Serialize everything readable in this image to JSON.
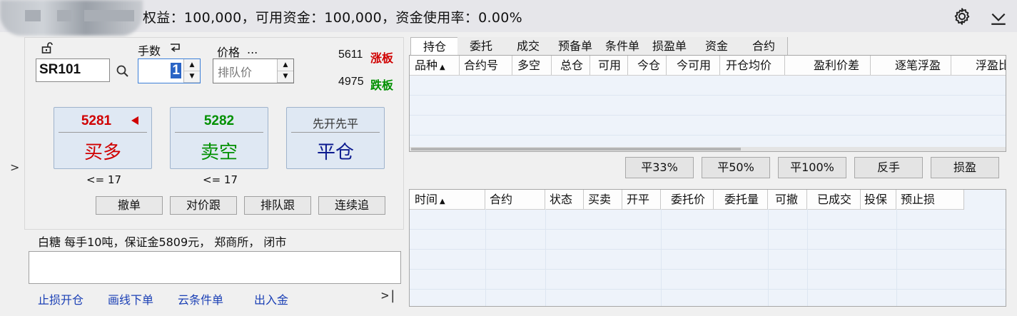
{
  "summary": "权益：100,000，可用资金：100,000，资金使用率：0.00%",
  "order": {
    "qty_label": "手数",
    "price_label": "价格",
    "price_more": "...",
    "code": "SR101",
    "qty": "1",
    "price_placeholder": "排队价",
    "limit_up_value": "5611",
    "limit_up_label": "涨板",
    "limit_down_value": "4975",
    "limit_down_label": "跌板"
  },
  "buttons": {
    "buy_price": "5281",
    "buy_label": "买多",
    "sell_price": "5282",
    "sell_label": "卖空",
    "close_mode": "先开先平",
    "close_label": "平仓",
    "buy_limit": "<= 17",
    "sell_limit": "<= 17"
  },
  "small_buttons": [
    "撤单",
    "对价跟",
    "排队跟",
    "连续追"
  ],
  "contract_info": "白糖  每手10吨，保证金5809元， 郑商所， 闭市",
  "links": [
    "止损开仓",
    "画线下单",
    "云条件单",
    "出入金"
  ],
  "more_icon": ">|",
  "expand_icon": ">",
  "tabs": [
    "持仓",
    "委托",
    "成交",
    "预备单",
    "条件单",
    "损盈单",
    "资金",
    "合约"
  ],
  "positions_columns": [
    "品种",
    "合约号",
    "多空",
    "总仓",
    "可用",
    "今仓",
    "今可用",
    "开仓均价",
    "盈利价差",
    "逐笔浮盈",
    "浮盈比"
  ],
  "sort_arrow": "▲",
  "position_actions": [
    "平33%",
    "平50%",
    "平100%",
    "反手",
    "损盈"
  ],
  "orders_columns": [
    "时间",
    "合约",
    "状态",
    "买卖",
    "开平",
    "委托价",
    "委托量",
    "可撤",
    "已成交",
    "投保",
    "预止损"
  ],
  "colors": {
    "buy": "#d00000",
    "sell": "#009000",
    "close": "#0b1a8f"
  }
}
